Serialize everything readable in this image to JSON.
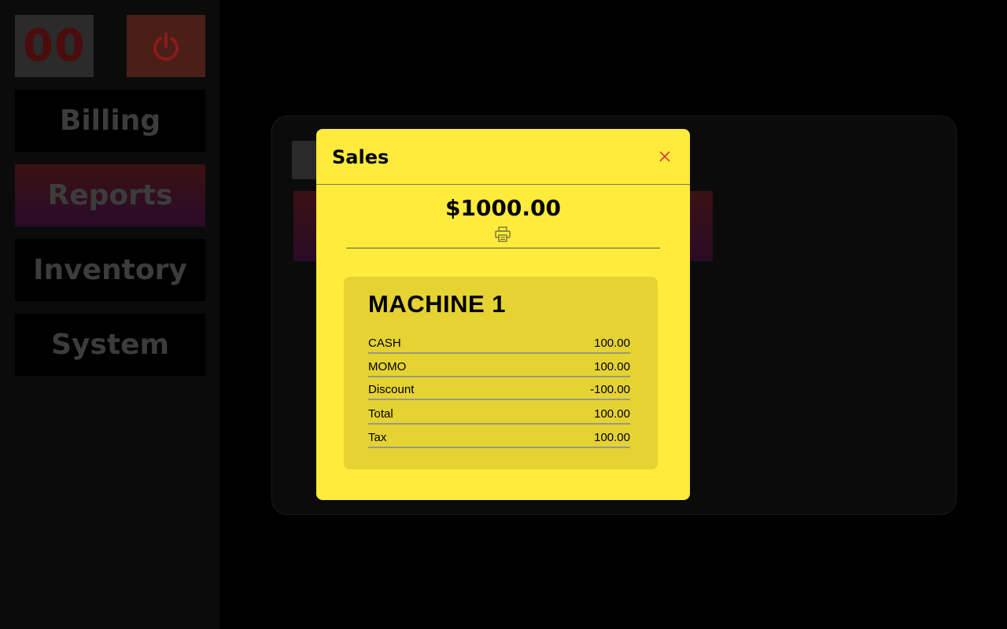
{
  "sidebar": {
    "counter": "00",
    "nav": [
      {
        "label": "Billing"
      },
      {
        "label": "Reports"
      },
      {
        "label": "Inventory"
      },
      {
        "label": "System"
      }
    ]
  },
  "modal": {
    "title": "Sales",
    "total": "$1000.00",
    "machine": {
      "name": "MACHINE 1",
      "rows": [
        {
          "label": "CASH",
          "value": "100.00"
        },
        {
          "label": "MOMO",
          "value": "100.00"
        },
        {
          "label": "Discount",
          "value": "-100.00"
        },
        {
          "label": "Total",
          "value": "100.00"
        },
        {
          "label": "Tax",
          "value": "100.00"
        }
      ]
    }
  },
  "icons": {
    "power": "power-icon",
    "close": "close-icon",
    "print": "printer-icon"
  },
  "colors": {
    "modal_bg": "#ffeb3b",
    "card_bg": "#e5d233",
    "close": "#e53935",
    "power": "#8b1a1a"
  }
}
